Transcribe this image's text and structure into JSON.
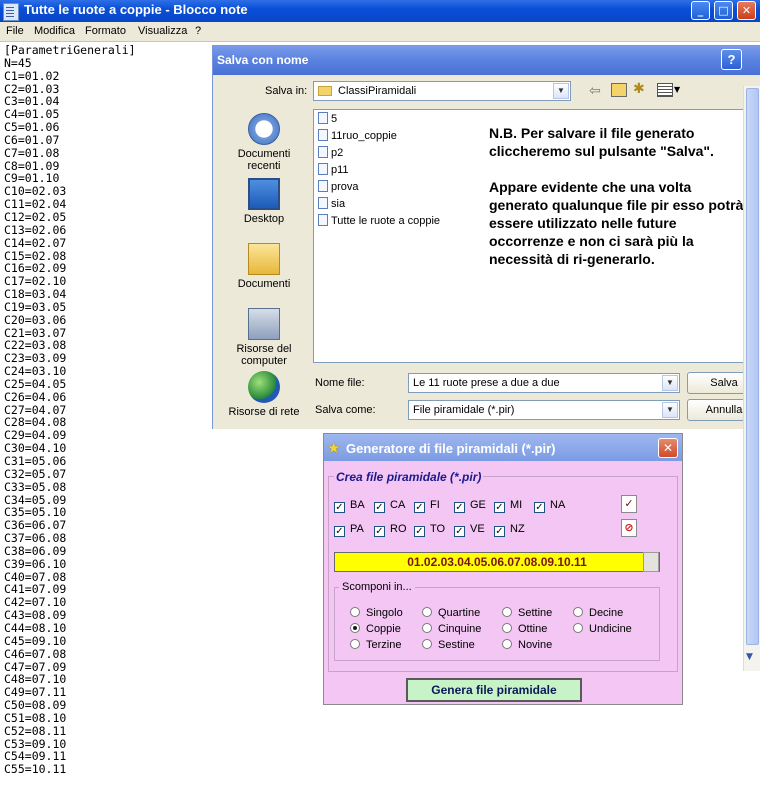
{
  "notepad": {
    "title": "Tutte le ruote a coppie - Blocco note",
    "menu": [
      "File",
      "Modifica",
      "Formato",
      "Visualizza",
      "?"
    ],
    "lines": [
      "[ParametriGenerali]",
      "N=45",
      "C1=01.02",
      "C2=01.03",
      "C3=01.04",
      "C4=01.05",
      "C5=01.06",
      "C6=01.07",
      "C7=01.08",
      "C8=01.09",
      "C9=01.10",
      "C10=02.03",
      "C11=02.04",
      "C12=02.05",
      "C13=02.06",
      "C14=02.07",
      "C15=02.08",
      "C16=02.09",
      "C17=02.10",
      "C18=03.04",
      "C19=03.05",
      "C20=03.06",
      "C21=03.07",
      "C22=03.08",
      "C23=03.09",
      "C24=03.10",
      "C25=04.05",
      "C26=04.06",
      "C27=04.07",
      "C28=04.08",
      "C29=04.09",
      "C30=04.10",
      "C31=05.06",
      "C32=05.07",
      "C33=05.08",
      "C34=05.09",
      "C35=05.10",
      "C36=06.07",
      "C37=06.08",
      "C38=06.09",
      "C39=06.10",
      "C40=07.08",
      "C41=07.09",
      "C42=07.10",
      "C43=08.09",
      "C44=08.10",
      "C45=09.10",
      "C46=07.08",
      "C47=07.09",
      "C48=07.10",
      "C49=07.11",
      "C50=08.09",
      "C51=08.10",
      "C52=08.11",
      "C53=09.10",
      "C54=09.11",
      "C55=10.11"
    ]
  },
  "save_dialog": {
    "title": "Salva con nome",
    "help": "?",
    "save_in_label": "Salva in:",
    "save_in_value": "ClassiPiramidali",
    "places": [
      "Documenti recenti",
      "Desktop",
      "Documenti",
      "Risorse del computer",
      "Risorse di rete"
    ],
    "files": [
      "5",
      "11ruo_coppie",
      "p2",
      "p11",
      "prova",
      "sia",
      "Tutte le ruote a coppie"
    ],
    "note_1": "N.B. Per salvare il file generato cliccheremo sul pulsante \"Salva\".",
    "note_2": "Appare evidente che una volta generato qualunque file pir esso potrà essere utilizzato nelle future occorrenze e non ci sarà più la necessità di ri-generarlo.",
    "filename_label": "Nome file:",
    "filename_value": "Le 11 ruote prese a due a due",
    "savetype_label": "Salva come:",
    "savetype_value": "File piramidale (*.pir)",
    "save_button": "Salva",
    "cancel_button": "Annulla"
  },
  "generator": {
    "title": "Generatore di file piramidali (*.pir)",
    "section_title": "Crea file piramidale (*.pir)",
    "wheels_row1": [
      "BA",
      "CA",
      "FI",
      "GE",
      "MI",
      "NA"
    ],
    "wheels_row2": [
      "PA",
      "RO",
      "TO",
      "VE",
      "NZ"
    ],
    "numbers": "01.02.03.04.05.06.07.08.09.10.11",
    "scomponi_label": "Scomponi in...",
    "options_col1": [
      "Singolo",
      "Coppie",
      "Terzine"
    ],
    "options_col2": [
      "Quartine",
      "Cinquine",
      "Sestine"
    ],
    "options_col3": [
      "Settine",
      "Ottine",
      "Novine"
    ],
    "options_col4": [
      "Decine",
      "Undicine"
    ],
    "selected_option": "Coppie",
    "generate_button": "Genera file piramidale"
  }
}
